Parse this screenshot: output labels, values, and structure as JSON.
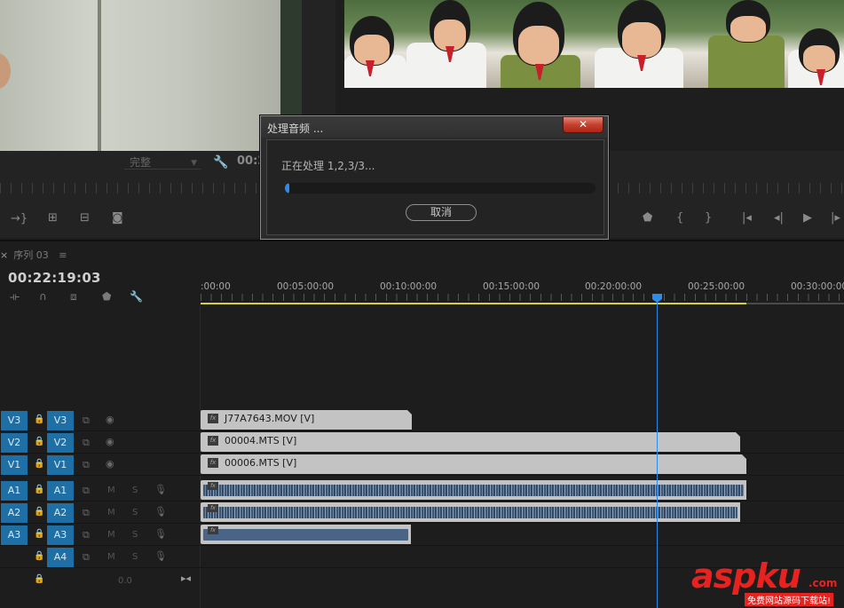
{
  "source_monitor": {
    "fit_value": "完整",
    "timecode": "00:2"
  },
  "dialog": {
    "title": "处理音频 ...",
    "close_glyph": "✕",
    "message": "正在处理 1,2,3/3...",
    "progress_fraction": 0.01,
    "cancel_label": "取消",
    "progress_color": "#2d8ceb"
  },
  "sequence": {
    "tab_label": "序列 03",
    "tab_close": "×",
    "tab_menu": "≡",
    "timecode": "00:22:19:03",
    "ruler_labels": [
      ":00:00",
      "00:05:00:00",
      "00:10:00:00",
      "00:15:00:00",
      "00:20:00:00",
      "00:25:00:00",
      "00:30:00:00"
    ],
    "playhead_color": "#2d8ceb",
    "work_area_color": "#d8d13a"
  },
  "tracks": {
    "video": [
      {
        "source": "V3",
        "target": "V3",
        "clip": "J77A7643.MOV [V]"
      },
      {
        "source": "V2",
        "target": "V2",
        "clip": "00004.MTS [V]"
      },
      {
        "source": "V1",
        "target": "V1",
        "clip": "00006.MTS [V]"
      }
    ],
    "audio": [
      {
        "source": "A1",
        "target": "A1",
        "m": "M",
        "s": "S"
      },
      {
        "source": "A2",
        "target": "A2",
        "m": "M",
        "s": "S"
      },
      {
        "source": "A3",
        "target": "A3",
        "m": "M",
        "s": "S"
      },
      {
        "source": "",
        "target": "A4",
        "m": "M",
        "s": "S"
      }
    ],
    "master_value": "0.0",
    "fx_badge": "fx"
  },
  "watermark": {
    "brand": "aspku",
    "suffix": ".com",
    "tagline": "免费网站源码下载站!"
  }
}
